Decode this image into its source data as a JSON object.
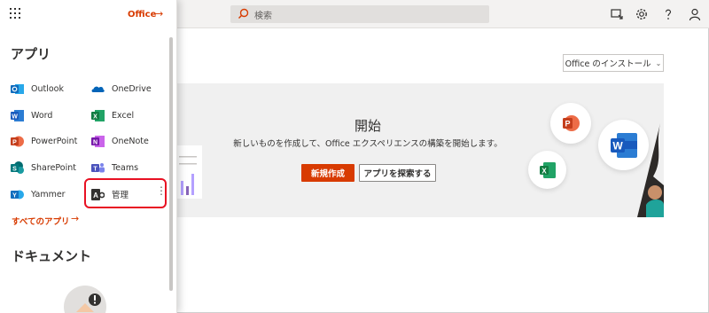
{
  "topbar": {
    "search_placeholder": "検索"
  },
  "panel": {
    "office_link": "Office",
    "office_arrow": "→",
    "apps_heading": "アプリ",
    "apps": [
      {
        "label": "Outlook",
        "icon": "outlook-icon",
        "color": "#0f6cbd"
      },
      {
        "label": "OneDrive",
        "icon": "onedrive-icon",
        "color": "#0364b8"
      },
      {
        "label": "Word",
        "icon": "word-icon",
        "color": "#185abd"
      },
      {
        "label": "Excel",
        "icon": "excel-icon",
        "color": "#107c41"
      },
      {
        "label": "PowerPoint",
        "icon": "powerpoint-icon",
        "color": "#c43e1c"
      },
      {
        "label": "OneNote",
        "icon": "onenote-icon",
        "color": "#7719aa"
      },
      {
        "label": "SharePoint",
        "icon": "sharepoint-icon",
        "color": "#036c70"
      },
      {
        "label": "Teams",
        "icon": "teams-icon",
        "color": "#4b53bc"
      },
      {
        "label": "Yammer",
        "icon": "yammer-icon",
        "color": "#106ebe"
      },
      {
        "label": "管理",
        "icon": "admin-icon",
        "color": "#323130"
      }
    ],
    "all_apps_link": "すべてのアプリ",
    "all_apps_arrow": "→",
    "docs_heading": "ドキュメント",
    "kebab": "⋮"
  },
  "main": {
    "install_button": "Office のインストール",
    "install_chevron": "⌄",
    "hero_title": "開始",
    "hero_subtitle": "新しいものを作成して、Office エクスペリエンスの構築を開始します。",
    "new_button": "新規作成",
    "explore_button": "アプリを探索する"
  },
  "colors": {
    "accent": "#d83b01",
    "highlight": "#e81123"
  }
}
